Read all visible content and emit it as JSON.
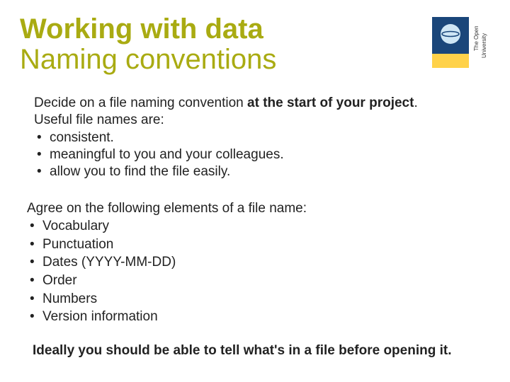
{
  "header": {
    "line1": "Working with data",
    "line2": "Naming conventions",
    "logo_alt": "The Open University"
  },
  "section1": {
    "intro_pre": "Decide on a file naming convention ",
    "intro_strong": "at the start of your project",
    "intro_post": ".",
    "useful_line": "Useful file names are:",
    "bullets": [
      "consistent.",
      "meaningful to you and your colleagues.",
      "allow you to find the file easily."
    ]
  },
  "section2": {
    "intro": "Agree on the following elements of a file name:",
    "bullets": [
      "Vocabulary",
      "Punctuation",
      "Dates (YYYY-MM-DD)",
      "Order",
      "Numbers",
      "Version information"
    ]
  },
  "closing": "Ideally you should be able to tell what's in a file before opening it."
}
